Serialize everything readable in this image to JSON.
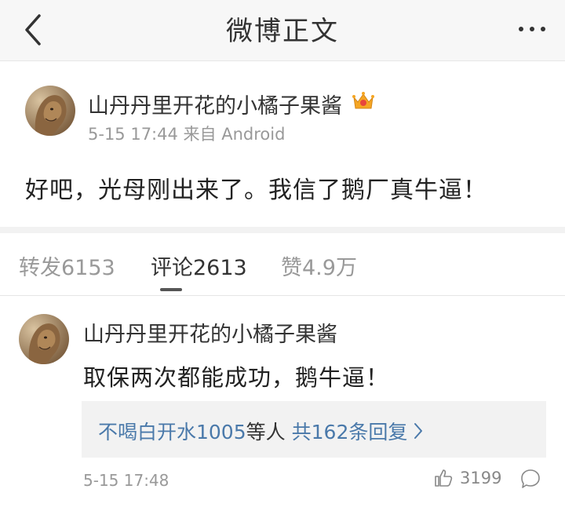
{
  "topbar": {
    "title": "微博正文"
  },
  "post": {
    "author": "山丹丹里开花的小橘子果酱",
    "meta": "5-15 17:44 来自 Android",
    "text": "好吧，光母刚出来了。我信了鹅厂真牛逼！"
  },
  "tabs": [
    {
      "label": "转发6153",
      "active": false
    },
    {
      "label": "评论2613",
      "active": true
    },
    {
      "label": "赞4.9万",
      "active": false
    }
  ],
  "comment": {
    "author": "山丹丹里开花的小橘子果酱",
    "text": "取保两次都能成功，鹅牛逼！",
    "replies_user": "不喝白开水1005",
    "replies_mid": "等人",
    "replies_count": "共162条回复",
    "time": "5-15 17:48",
    "likes": "3199"
  },
  "colors": {
    "link_blue": "#4a79aa",
    "crown_gold": "#f5a623",
    "crown_red": "#e8453c"
  },
  "icons": [
    "back-arrow-icon",
    "more-dots-icon",
    "crown-icon",
    "thumbs-up-icon",
    "comment-bubble-icon",
    "chevron-right-icon"
  ]
}
